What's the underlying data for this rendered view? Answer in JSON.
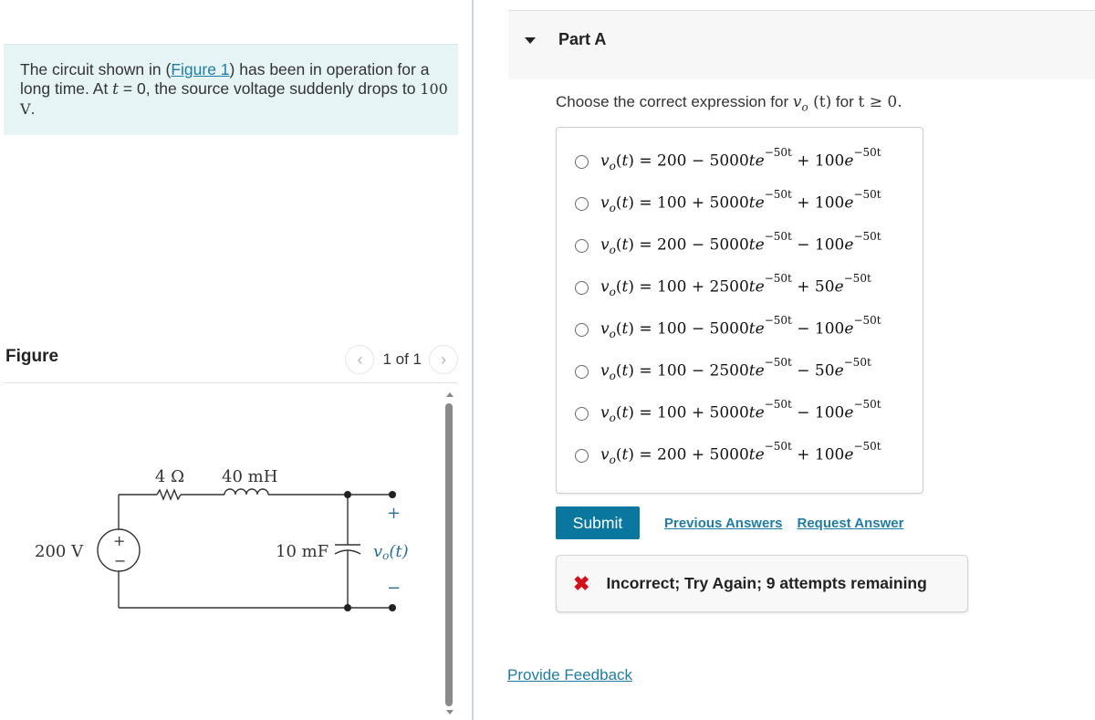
{
  "problem": {
    "intro_before_link": "The circuit shown in (",
    "figure_link": "Figure 1",
    "intro_after_link": ") has been in operation for a long time. At ",
    "var_t": "t",
    "intro_eq": " = 0, the source voltage suddenly drops to ",
    "new_voltage": "100 V",
    "intro_end": "."
  },
  "figure": {
    "title": "Figure",
    "pager_text": "1 of 1",
    "prev_icon": "chevron-left-icon",
    "next_icon": "chevron-right-icon",
    "circuit": {
      "resistor_label": "4 Ω",
      "inductor_label": "40 mH",
      "source_label": "200 V",
      "capacitor_label": "10 mF",
      "output_label": "vo(t)",
      "output_var": "v",
      "output_sub": "o",
      "output_arg": "(t)",
      "plus": "+",
      "minus": "−",
      "accent_color": "#2a6f95"
    }
  },
  "part": {
    "title": "Part A",
    "question_prefix": "Choose the correct expression for ",
    "question_var": "v",
    "question_sub": "o",
    "question_arg": " (t)",
    "question_mid": " for ",
    "question_cond": "t ≥ 0.",
    "choices": [
      {
        "lhs": "vo(t) =",
        "const": "200",
        "op1": "−",
        "coef1": "5000",
        "op2": "+",
        "coef2": "100",
        "exp": "−50t"
      },
      {
        "lhs": "vo(t) =",
        "const": "100",
        "op1": "+",
        "coef1": "5000",
        "op2": "+",
        "coef2": "100",
        "exp": "−50t"
      },
      {
        "lhs": "vo(t) =",
        "const": "200",
        "op1": "−",
        "coef1": "5000",
        "op2": "−",
        "coef2": "100",
        "exp": "−50t"
      },
      {
        "lhs": "vo(t) =",
        "const": "100",
        "op1": "+",
        "coef1": "2500",
        "op2": "+",
        "coef2": "50",
        "exp": "−50t"
      },
      {
        "lhs": "vo(t) =",
        "const": "100",
        "op1": "−",
        "coef1": "5000",
        "op2": "−",
        "coef2": "100",
        "exp": "−50t"
      },
      {
        "lhs": "vo(t) =",
        "const": "100",
        "op1": "−",
        "coef1": "2500",
        "op2": "−",
        "coef2": "50",
        "exp": "−50t"
      },
      {
        "lhs": "vo(t) =",
        "const": "100",
        "op1": "+",
        "coef1": "5000",
        "op2": "−",
        "coef2": "100",
        "exp": "−50t"
      },
      {
        "lhs": "vo(t) =",
        "const": "200",
        "op1": "+",
        "coef1": "5000",
        "op2": "+",
        "coef2": "100",
        "exp": "−50t"
      }
    ],
    "submit_label": "Submit",
    "previous_answers_label": "Previous Answers",
    "request_answer_label": "Request Answer",
    "feedback_icon": "x-icon",
    "feedback_text": "Incorrect; Try Again; 9 attempts remaining",
    "feedback_icon_color": "#d3101c",
    "submit_color": "#0a779e"
  },
  "footer": {
    "provide_feedback_label": "Provide Feedback"
  }
}
